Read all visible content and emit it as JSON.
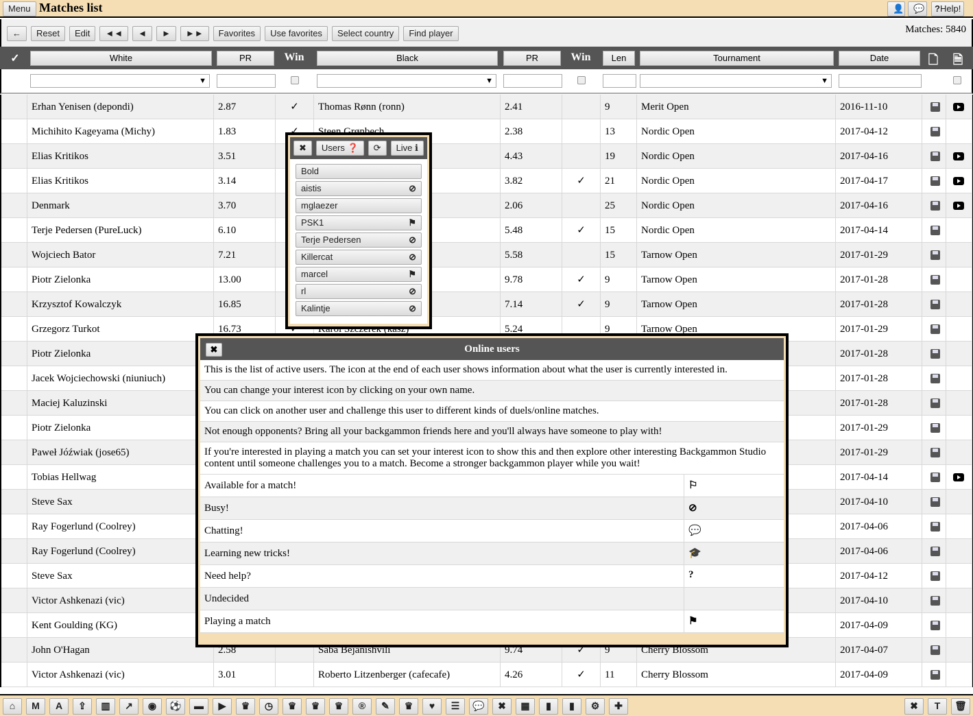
{
  "topbar": {
    "menu": "Menu",
    "title": "Matches list",
    "user_icon": "user-icon",
    "chat_icon": "chat-icon",
    "help": "Help!"
  },
  "toolbar": {
    "back_icon": "arrow-left-icon",
    "buttons": [
      "Reset",
      "Edit",
      "◄◄",
      "◄",
      "►",
      "►►",
      "Favorites",
      "Use favorites",
      "Select country",
      "Find player"
    ],
    "matches": "Matches: 5840"
  },
  "header": {
    "check": "✓",
    "white": "White",
    "pr1": "PR",
    "win1": "Win",
    "black": "Black",
    "pr2": "PR",
    "win2": "Win",
    "len": "Len",
    "tournament": "Tournament",
    "date": "Date"
  },
  "rows": [
    {
      "white": "Erhan Yenisen (depondi)",
      "pr1": "2.87",
      "win1": "✓",
      "black": "Thomas Rønn (ronn)",
      "pr2": "2.41",
      "win2": "",
      "len": "9",
      "tournament": "Merit Open",
      "date": "2016-11-10",
      "video": true
    },
    {
      "white": "Michihito Kageyama (Michy)",
      "pr1": "1.83",
      "win1": "✓",
      "black": "Steen Grønbech",
      "pr2": "2.38",
      "win2": "",
      "len": "13",
      "tournament": "Nordic Open",
      "date": "2017-04-12",
      "video": false
    },
    {
      "white": "Elias Kritikos",
      "pr1": "3.51",
      "win1": "",
      "black": "",
      "pr2": "4.43",
      "win2": "",
      "len": "19",
      "tournament": "Nordic Open",
      "date": "2017-04-16",
      "video": true
    },
    {
      "white": "Elias Kritikos",
      "pr1": "3.14",
      "win1": "",
      "black": "",
      "pr2": "3.82",
      "win2": "✓",
      "len": "21",
      "tournament": "Nordic Open",
      "date": "2017-04-17",
      "video": true
    },
    {
      "white": "Denmark",
      "pr1": "3.70",
      "win1": "",
      "black": "",
      "pr2": "2.06",
      "win2": "",
      "len": "25",
      "tournament": "Nordic Open",
      "date": "2017-04-16",
      "video": true
    },
    {
      "white": "Terje Pedersen (PureLuck)",
      "pr1": "6.10",
      "win1": "",
      "black": "",
      "pr2": "5.48",
      "win2": "✓",
      "len": "15",
      "tournament": "Nordic Open",
      "date": "2017-04-14",
      "video": false
    },
    {
      "white": "Wojciech Bator",
      "pr1": "7.21",
      "win1": "",
      "black": "",
      "pr2": "5.58",
      "win2": "",
      "len": "15",
      "tournament": "Tarnow Open",
      "date": "2017-01-29",
      "video": false
    },
    {
      "white": "Piotr Zielonka",
      "pr1": "13.00",
      "win1": "",
      "black": "",
      "pr2": "9.78",
      "win2": "✓",
      "len": "9",
      "tournament": "Tarnow Open",
      "date": "2017-01-28",
      "video": false
    },
    {
      "white": "Krzysztof Kowalczyk",
      "pr1": "16.85",
      "win1": "",
      "black": "",
      "pr2": "7.14",
      "win2": "✓",
      "len": "9",
      "tournament": "Tarnow Open",
      "date": "2017-01-28",
      "video": false
    },
    {
      "white": "Grzegorz Turkot",
      "pr1": "16.73",
      "win1": "✓",
      "black": "Karol Szczerek (kasz)",
      "pr2": "5.24",
      "win2": "",
      "len": "9",
      "tournament": "Tarnow Open",
      "date": "2017-01-29",
      "video": false
    },
    {
      "white": "Piotr Zielonka",
      "date": "2017-01-28",
      "video": false
    },
    {
      "white": "Jacek Wojciechowski (niuniuch)",
      "date": "2017-01-28",
      "video": false
    },
    {
      "white": "Maciej Kaluzinski",
      "date": "2017-01-28",
      "video": false
    },
    {
      "white": "Piotr Zielonka",
      "date": "2017-01-29",
      "video": false
    },
    {
      "white": "Paweł Jóźwiak (jose65)",
      "date": "2017-01-29",
      "video": false
    },
    {
      "white": "Tobias Hellwag",
      "date": "2017-04-14",
      "video": true
    },
    {
      "white": "Steve Sax",
      "date": "2017-04-10",
      "video": false
    },
    {
      "white": "Ray Fogerlund (Coolrey)",
      "date": "2017-04-06",
      "video": false
    },
    {
      "white": "Ray Fogerlund (Coolrey)",
      "date": "2017-04-06",
      "video": false
    },
    {
      "white": "Steve Sax",
      "date": "2017-04-12",
      "video": false
    },
    {
      "white": "Victor Ashkenazi (vic)",
      "date": "2017-04-10",
      "video": false
    },
    {
      "white": "Kent Goulding (KG)",
      "date": "2017-04-09",
      "video": false
    },
    {
      "white": "John O'Hagan",
      "pr1": "2.58",
      "win1": "",
      "black": "Saba Bejanishvili",
      "pr2": "9.74",
      "win2": "✓",
      "len": "9",
      "tournament": "Cherry Blossom",
      "date": "2017-04-07",
      "video": false
    },
    {
      "white": "Victor Ashkenazi (vic)",
      "pr1": "3.01",
      "win1": "",
      "black": "Roberto Litzenberger (cafecafe)",
      "pr2": "4.26",
      "win2": "✓",
      "len": "11",
      "tournament": "Cherry Blossom",
      "date": "2017-04-09",
      "video": false
    }
  ],
  "users_popup": {
    "close": "✖",
    "users": "Users ❓",
    "refresh": "⟳",
    "live": "Live ℹ",
    "list": [
      {
        "name": "Bold",
        "icon": ""
      },
      {
        "name": "aistis",
        "icon": "⊘"
      },
      {
        "name": "mglaezer",
        "icon": ""
      },
      {
        "name": "PSK1",
        "icon": "⚑"
      },
      {
        "name": "Terje Pedersen",
        "icon": "⊘"
      },
      {
        "name": "Killercat",
        "icon": "⊘"
      },
      {
        "name": "marcel",
        "icon": "⚑"
      },
      {
        "name": "rl",
        "icon": "⊘"
      },
      {
        "name": "Kalintje",
        "icon": "⊘"
      }
    ]
  },
  "online_popup": {
    "close": "✖",
    "title": "Online users",
    "paragraphs": [
      "This is the list of active users. The icon at the end of each user shows information about what the user is currently interested in.",
      "You can change your interest icon by clicking on your own name.",
      "You can click on another user and challenge this user to different kinds of duels/online matches.",
      "Not enough opponents? Bring all your backgammon friends here and you'll always have someone to play with!",
      "If you're interested in playing a match you can set your interest icon to show this and then explore other interesting Backgammon Studio content until someone challenges you to a match. Become a stronger backgammon player while you wait!"
    ],
    "interests": [
      {
        "label": "Available for a match!",
        "icon": "⚐"
      },
      {
        "label": "Busy!",
        "icon": "⊘"
      },
      {
        "label": "Chatting!",
        "icon": "💬"
      },
      {
        "label": "Learning new tricks!",
        "icon": "🎓"
      },
      {
        "label": "Need help?",
        "icon": "?"
      },
      {
        "label": "Undecided",
        "icon": ""
      },
      {
        "label": "Playing a match",
        "icon": "⚑"
      }
    ]
  },
  "bottombar": {
    "left": [
      "⌂",
      "M",
      "A",
      "⇪",
      "▥",
      "↗",
      "◉",
      "⚽",
      "▬",
      "▶",
      "♛",
      "◷",
      "♛",
      "♛",
      "♛",
      "®",
      "✎",
      "♛",
      "♥",
      "☰",
      "💬",
      "✖",
      "▦",
      "▮",
      "▮",
      "⚙",
      "✚"
    ],
    "right": [
      "✖",
      "T",
      "🗑"
    ]
  }
}
